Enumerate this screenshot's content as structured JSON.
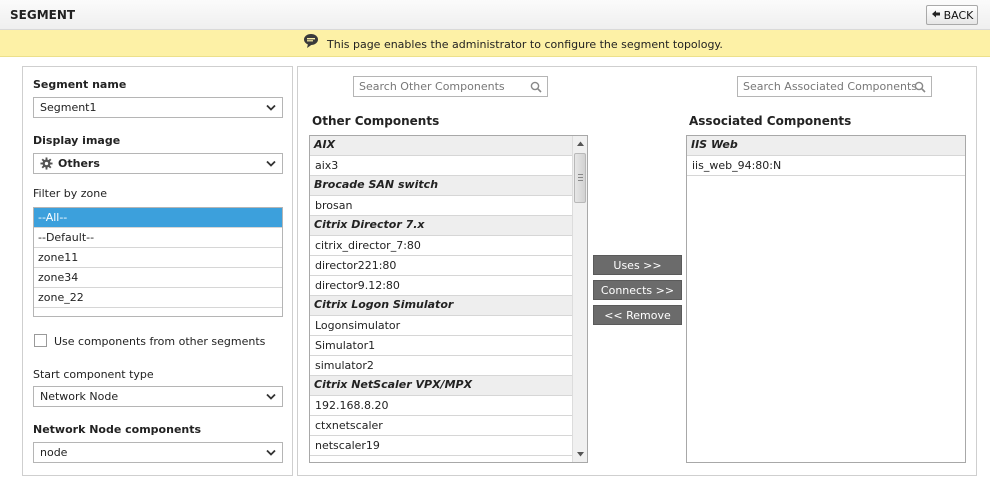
{
  "header": {
    "title": "SEGMENT",
    "back_label": "BACK"
  },
  "info": {
    "text": "This page enables the administrator to configure the segment topology."
  },
  "left": {
    "segment_name_label": "Segment name",
    "segment_name_value": "Segment1",
    "display_image_label": "Display image",
    "display_image_value": "Others",
    "filter_zone_label": "Filter by zone",
    "zones": [
      "--All--",
      "--Default--",
      "zone11",
      "zone34",
      "zone_22"
    ],
    "use_other_segments_label": "Use components from other segments",
    "start_type_label": "Start component type",
    "start_type_value": "Network Node",
    "node_components_label": "Network Node components",
    "node_components_value": "node"
  },
  "other": {
    "search_placeholder": "Search Other Components",
    "title": "Other Components",
    "groups": [
      {
        "name": "AIX",
        "items": [
          "aix3"
        ]
      },
      {
        "name": "Brocade SAN switch",
        "items": [
          "brosan"
        ]
      },
      {
        "name": "Citrix Director 7.x",
        "items": [
          "citrix_director_7:80",
          "director221:80",
          "director9.12:80"
        ]
      },
      {
        "name": "Citrix Logon Simulator",
        "items": [
          "Logonsimulator",
          "Simulator1",
          "simulator2"
        ]
      },
      {
        "name": "Citrix NetScaler VPX/MPX",
        "items": [
          "192.168.8.20",
          "ctxnetscaler",
          "netscaler19"
        ]
      }
    ]
  },
  "actions": {
    "uses": "Uses >>",
    "connects": "Connects >>",
    "remove": "<< Remove"
  },
  "associated": {
    "search_placeholder": "Search Associated Components",
    "title": "Associated Components",
    "groups": [
      {
        "name": "IIS Web",
        "items": [
          "iis_web_94:80:N"
        ]
      }
    ]
  },
  "colors": {
    "info_bg": "#fdf1a6",
    "selected_bg": "#3ca0dc",
    "button_bg": "#6b6b6b"
  }
}
